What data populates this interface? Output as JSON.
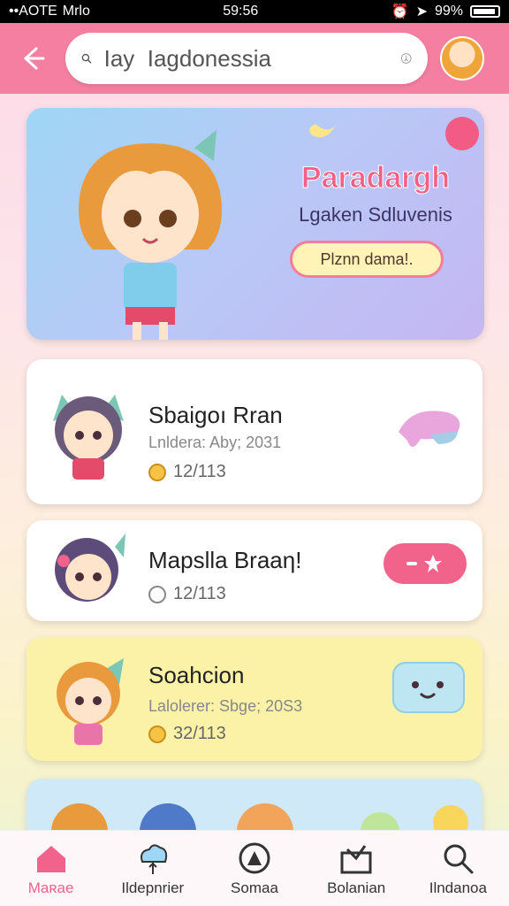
{
  "status_bar": {
    "carrier": "••AOTE",
    "app": "Mrlo",
    "time": "59:56",
    "battery": "99%"
  },
  "header": {
    "search_value": "Iay  Iagdonessia"
  },
  "banner": {
    "title": "Paradargh",
    "subtitle": "Lgaken Sdluvenis",
    "button_label": "Plznn dama!."
  },
  "cards": [
    {
      "title": "Sbaigoı Rran",
      "meta": "Lnldera: Aby; 2031",
      "count": "12/113"
    },
    {
      "title": "Mapslla Braaη!",
      "meta": "",
      "count": "12/113"
    },
    {
      "title": "Soahcion",
      "meta": "Lalolerer: Sbge; 20S3",
      "count": "32/113"
    }
  ],
  "nav": [
    {
      "label": "Maʀae",
      "icon": "home-icon"
    },
    {
      "label": "Ildepnrier",
      "icon": "cloud-icon"
    },
    {
      "label": "Somaa",
      "icon": "compass-icon"
    },
    {
      "label": "Bolanian",
      "icon": "inbox-icon"
    },
    {
      "label": "Ilndanoa",
      "icon": "search-icon"
    }
  ],
  "colors": {
    "accent": "#f2638b",
    "header": "#f47fa0"
  }
}
